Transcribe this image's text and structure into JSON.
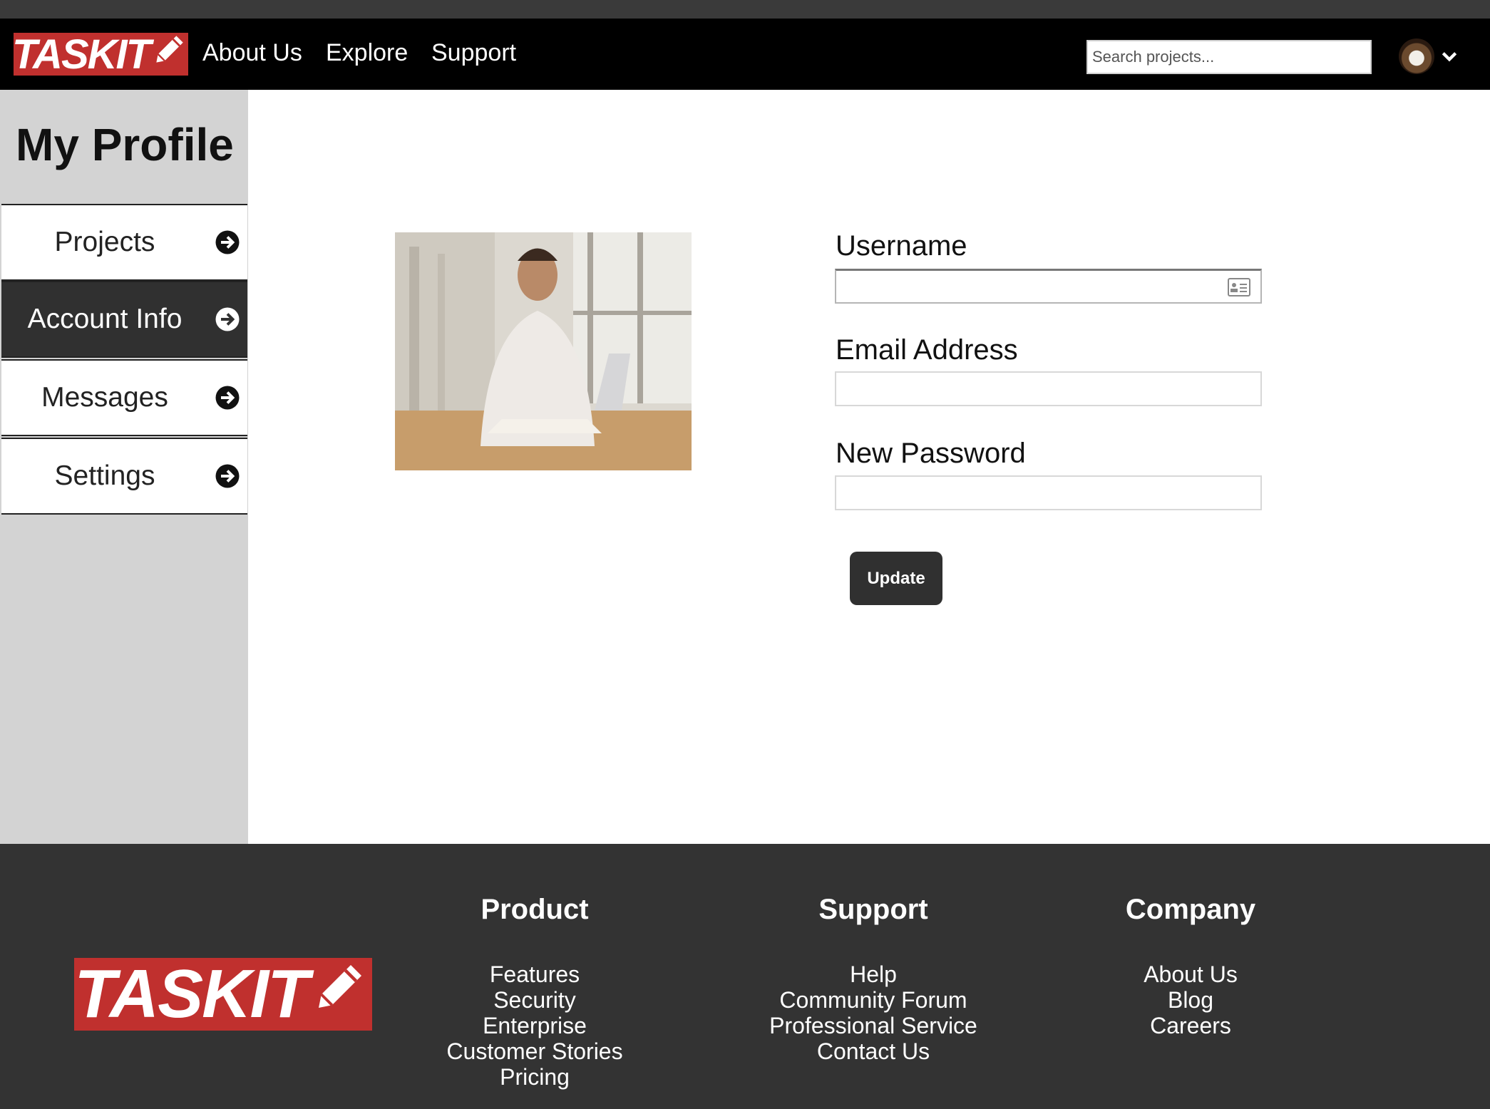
{
  "brand": {
    "logo_text": "TASKIT",
    "accent": "#c0302e"
  },
  "nav": {
    "links": [
      "About Us",
      "Explore",
      "Support"
    ],
    "search_placeholder": "Search projects..."
  },
  "sidebar": {
    "title": "My Profile",
    "items": [
      {
        "label": "Projects",
        "icon": "arrow-circle-right-icon"
      },
      {
        "label": "Account Info",
        "icon": "arrow-circle-right-icon",
        "active": true
      },
      {
        "label": "Messages",
        "icon": "arrow-circle-right-icon"
      },
      {
        "label": "Settings",
        "icon": "arrow-circle-right-icon"
      }
    ]
  },
  "form": {
    "username_label": "Username",
    "username_value": "",
    "email_label": "Email Address",
    "email_value": "",
    "password_label": "New Password",
    "password_value": "",
    "update_label": "Update"
  },
  "footer": {
    "logo_text": "TASKIT",
    "columns": [
      {
        "heading": "Product",
        "links": [
          "Features",
          "Security",
          "Enterprise",
          "Customer Stories",
          "Pricing"
        ]
      },
      {
        "heading": "Support",
        "links": [
          "Help",
          "Community Forum",
          "Professional Service",
          "Contact Us"
        ]
      },
      {
        "heading": "Company",
        "links": [
          "About Us",
          "Blog",
          "Careers"
        ]
      }
    ]
  },
  "colors": {
    "navbar": "#000000",
    "sidebar": "#d3d3d3",
    "active_item": "#303030",
    "footer": "#333333"
  }
}
